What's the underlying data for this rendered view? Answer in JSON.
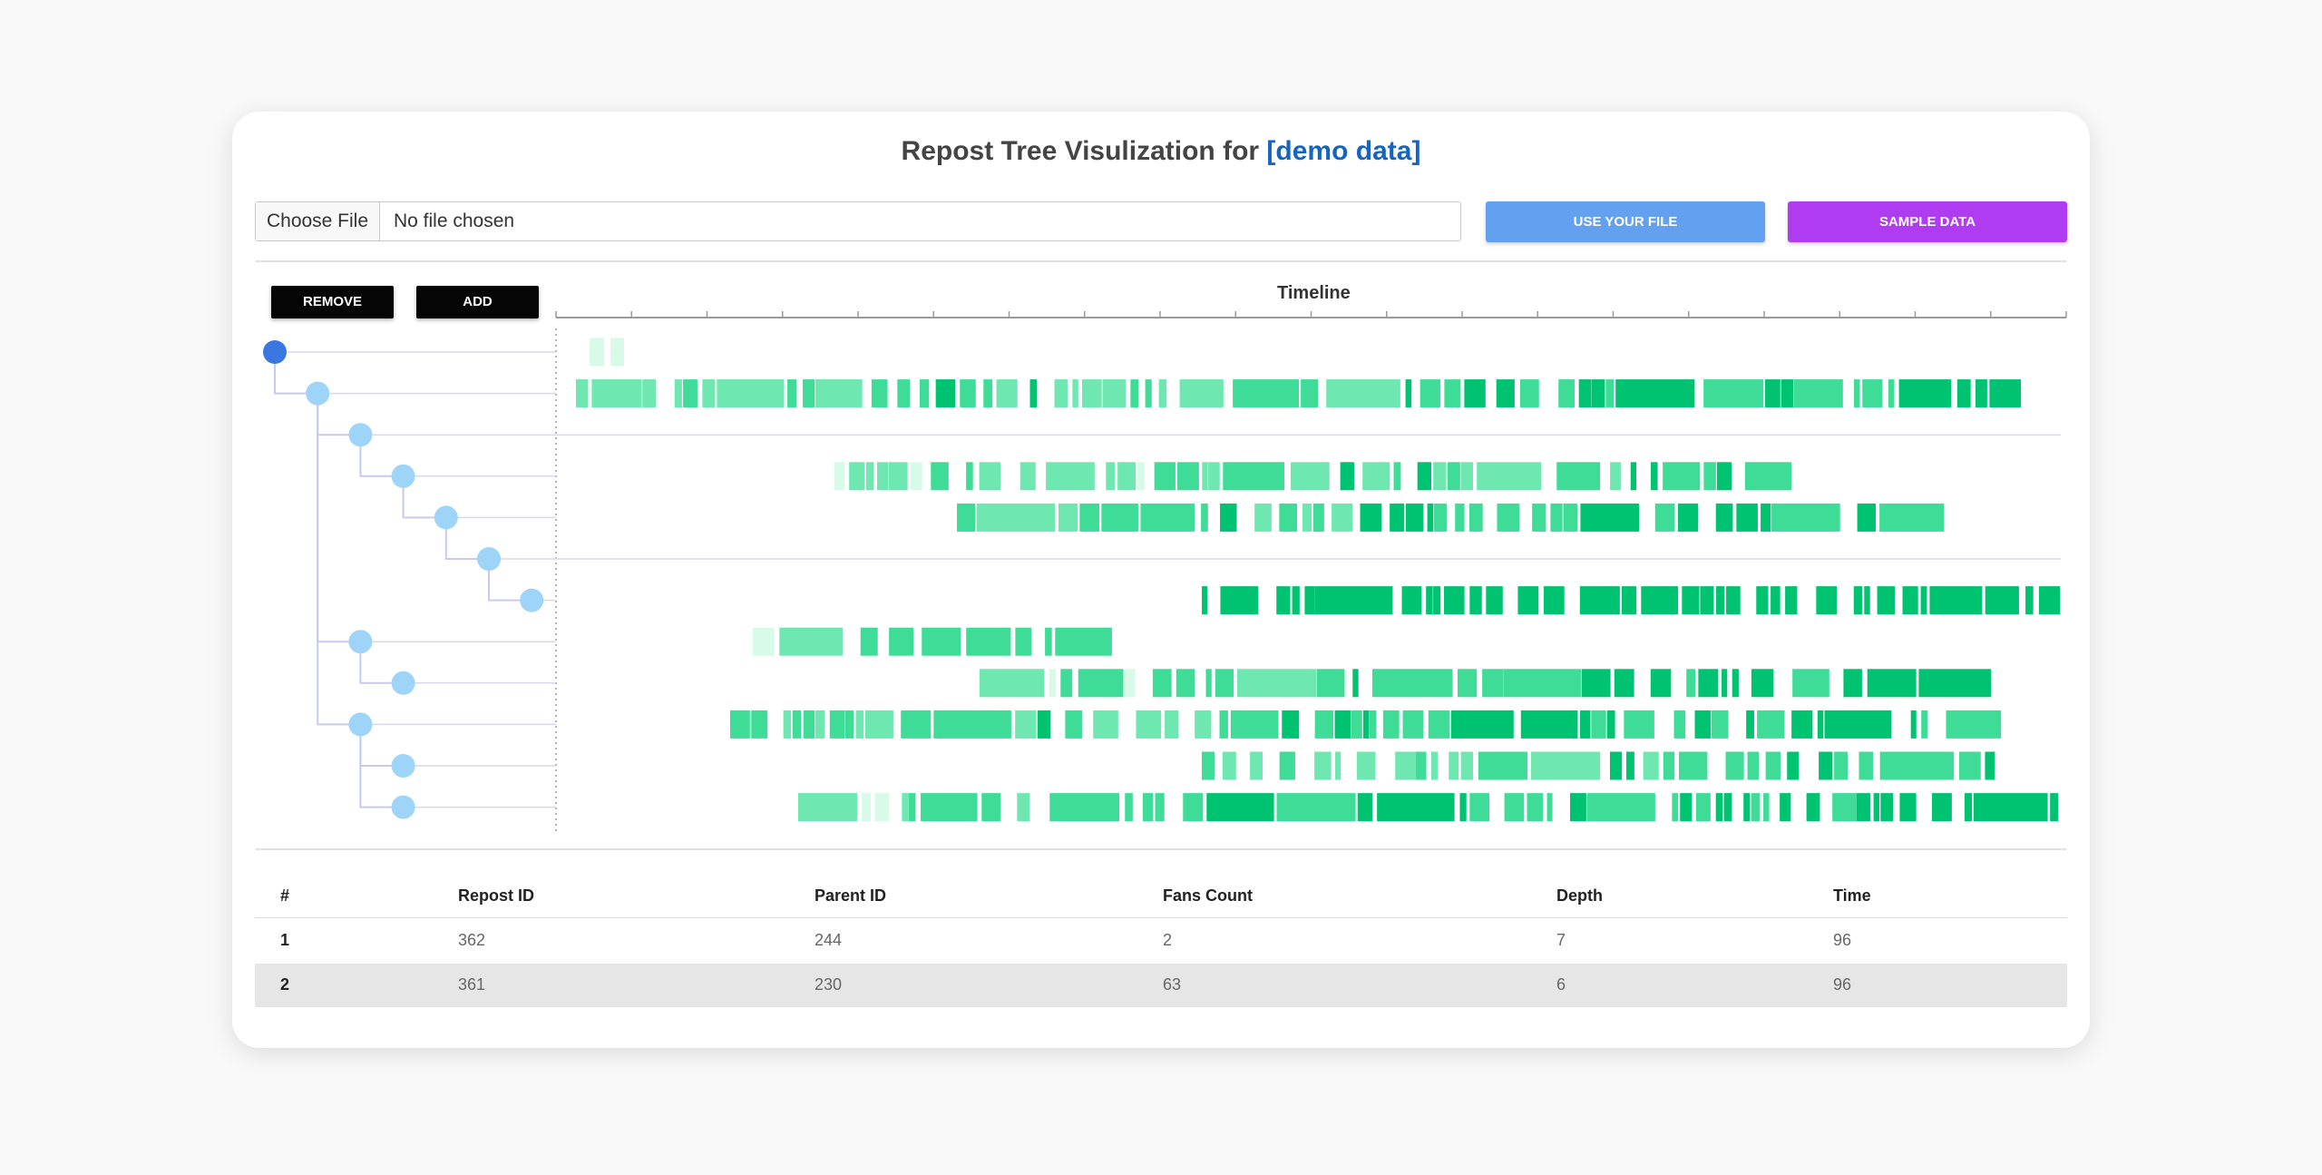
{
  "header": {
    "title_prefix": "Repost Tree Visulization for ",
    "title_dataset": "[demo data]"
  },
  "file_input": {
    "button_label": "Choose File",
    "status": "No file chosen"
  },
  "buttons": {
    "use_file": "USE YOUR FILE",
    "sample_data": "SAMPLE DATA",
    "remove": "REMOVE",
    "add": "ADD"
  },
  "timeline": {
    "label": "Timeline",
    "tick_count": 21
  },
  "tree": {
    "nodes": [
      {
        "depth": 0,
        "root": true
      },
      {
        "depth": 1
      },
      {
        "depth": 2
      },
      {
        "depth": 3
      },
      {
        "depth": 4
      },
      {
        "depth": 5
      },
      {
        "depth": 6
      },
      {
        "depth": 2
      },
      {
        "depth": 3
      },
      {
        "depth": 2
      },
      {
        "depth": 3
      },
      {
        "depth": 3
      }
    ],
    "colors": {
      "root": "#3a77e0",
      "node": "#9ed4f8",
      "link": "#c9c9f0",
      "bar_light": "#d7fbe8",
      "bar_mid": "#6ee8b0",
      "bar_dark": "#00c371"
    }
  },
  "table": {
    "headers": [
      "#",
      "Repost ID",
      "Parent ID",
      "Fans Count",
      "Depth",
      "Time"
    ],
    "rows": [
      [
        "1",
        "362",
        "244",
        "2",
        "7",
        "96"
      ],
      [
        "2",
        "361",
        "230",
        "63",
        "6",
        "96"
      ]
    ]
  }
}
